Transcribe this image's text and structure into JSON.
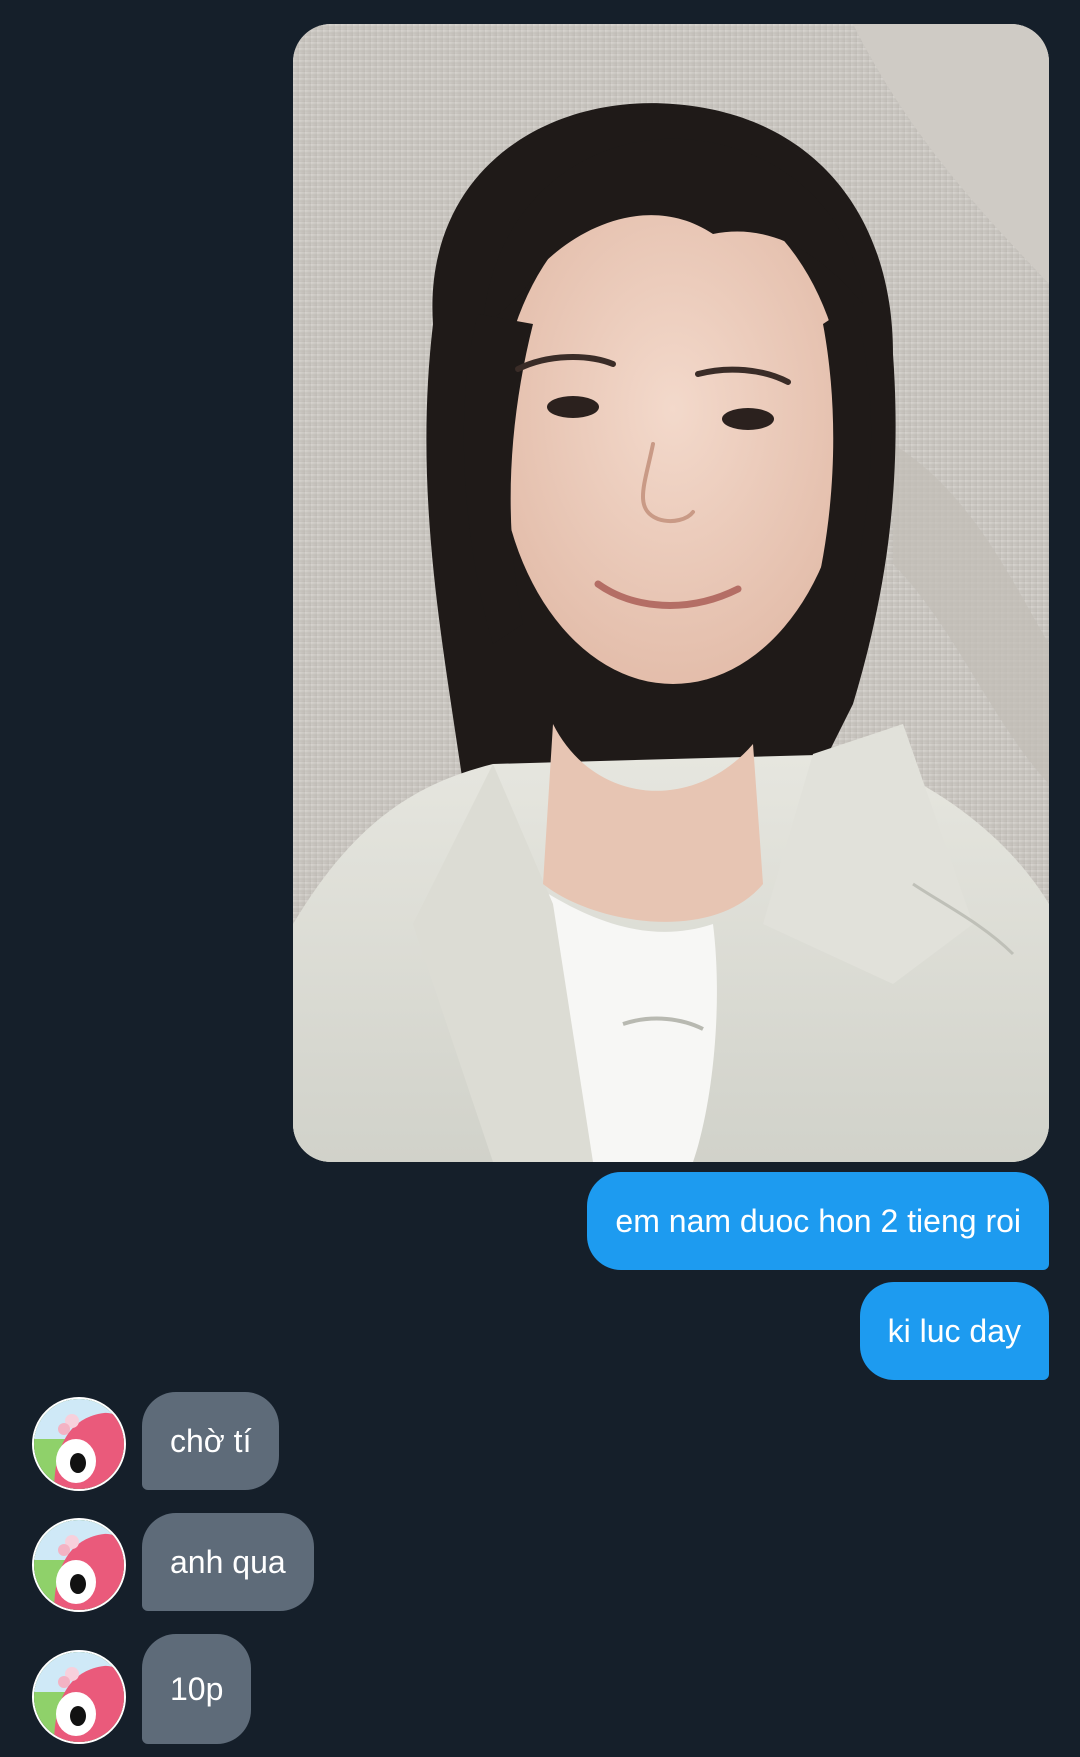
{
  "conversation": {
    "image_message": {
      "description_name": "selfie-photo"
    },
    "outgoing": [
      {
        "text": "em nam duoc hon 2 tieng roi"
      },
      {
        "text": "ki luc day"
      }
    ],
    "incoming": [
      {
        "text": "chờ tí"
      },
      {
        "text": "anh qua"
      },
      {
        "text": "10p"
      }
    ]
  },
  "colors": {
    "background": "#151f2a",
    "outgoing_bubble": "#1d9bf0",
    "incoming_bubble": "#5e6b79",
    "text": "#ffffff"
  }
}
